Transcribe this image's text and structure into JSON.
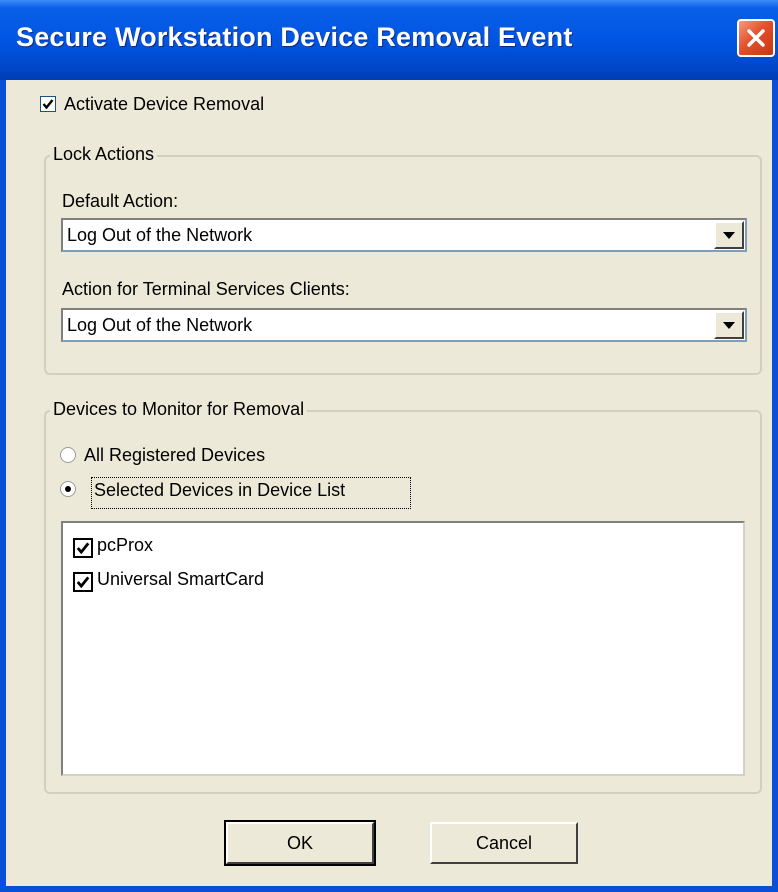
{
  "window": {
    "title": "Secure Workstation Device Removal Event"
  },
  "activate": {
    "label": "Activate Device Removal",
    "checked": true
  },
  "lock_actions": {
    "legend": "Lock Actions",
    "default_label": "Default Action:",
    "default_value": "Log Out of the Network",
    "terminal_label": "Action for Terminal Services Clients:",
    "terminal_value": "Log Out of the Network"
  },
  "devices": {
    "legend": "Devices to Monitor for Removal",
    "radio_all": "All Registered Devices",
    "radio_selected": "Selected Devices in Device List",
    "selected_option": "selected",
    "list": [
      {
        "label": "pcProx",
        "checked": true
      },
      {
        "label": "Universal SmartCard",
        "checked": true
      }
    ]
  },
  "buttons": {
    "ok": "OK",
    "cancel": "Cancel"
  },
  "icons": {
    "close": "close-icon",
    "dropdown": "chevron-down-icon",
    "check": "checkmark-icon"
  },
  "colors": {
    "titlebar": "#0055e3",
    "face": "#ece9d8",
    "close": "#e4502c"
  }
}
